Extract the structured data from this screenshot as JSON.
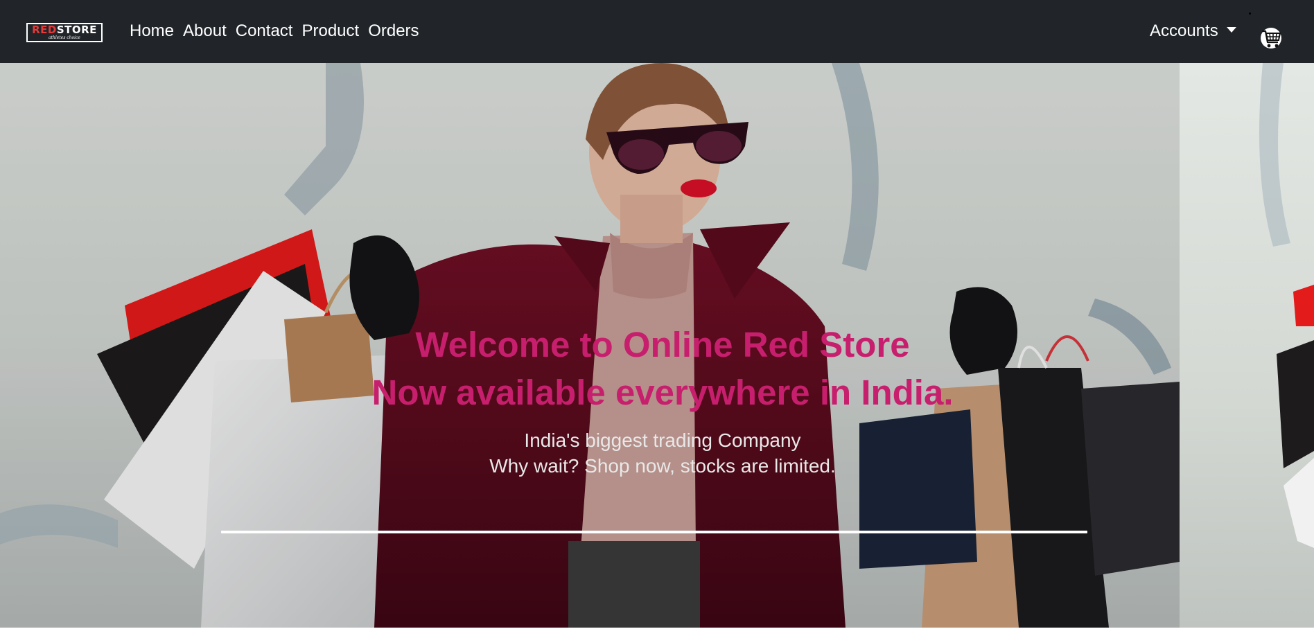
{
  "brand": {
    "name_red": "RED",
    "name_white": "STORE",
    "tagline": "athletes choice",
    "accent_color": "#e53a3a"
  },
  "nav": {
    "links": [
      "Home",
      "About",
      "Contact",
      "Product",
      "Orders"
    ],
    "accounts_label": "Accounts",
    "cart_icon": "shopping-cart-icon",
    "accounts_icon": "caret-down-icon"
  },
  "hero": {
    "heading_line1": "Welcome to Online Red Store",
    "heading_line2": "Now available everywhere in India.",
    "sub_line1": "India's biggest trading Company",
    "sub_line2": "Why wait? Shop now, stocks are limited.",
    "heading_color": "#c71f6d",
    "image": "woman-with-shopping-bags-photo"
  }
}
